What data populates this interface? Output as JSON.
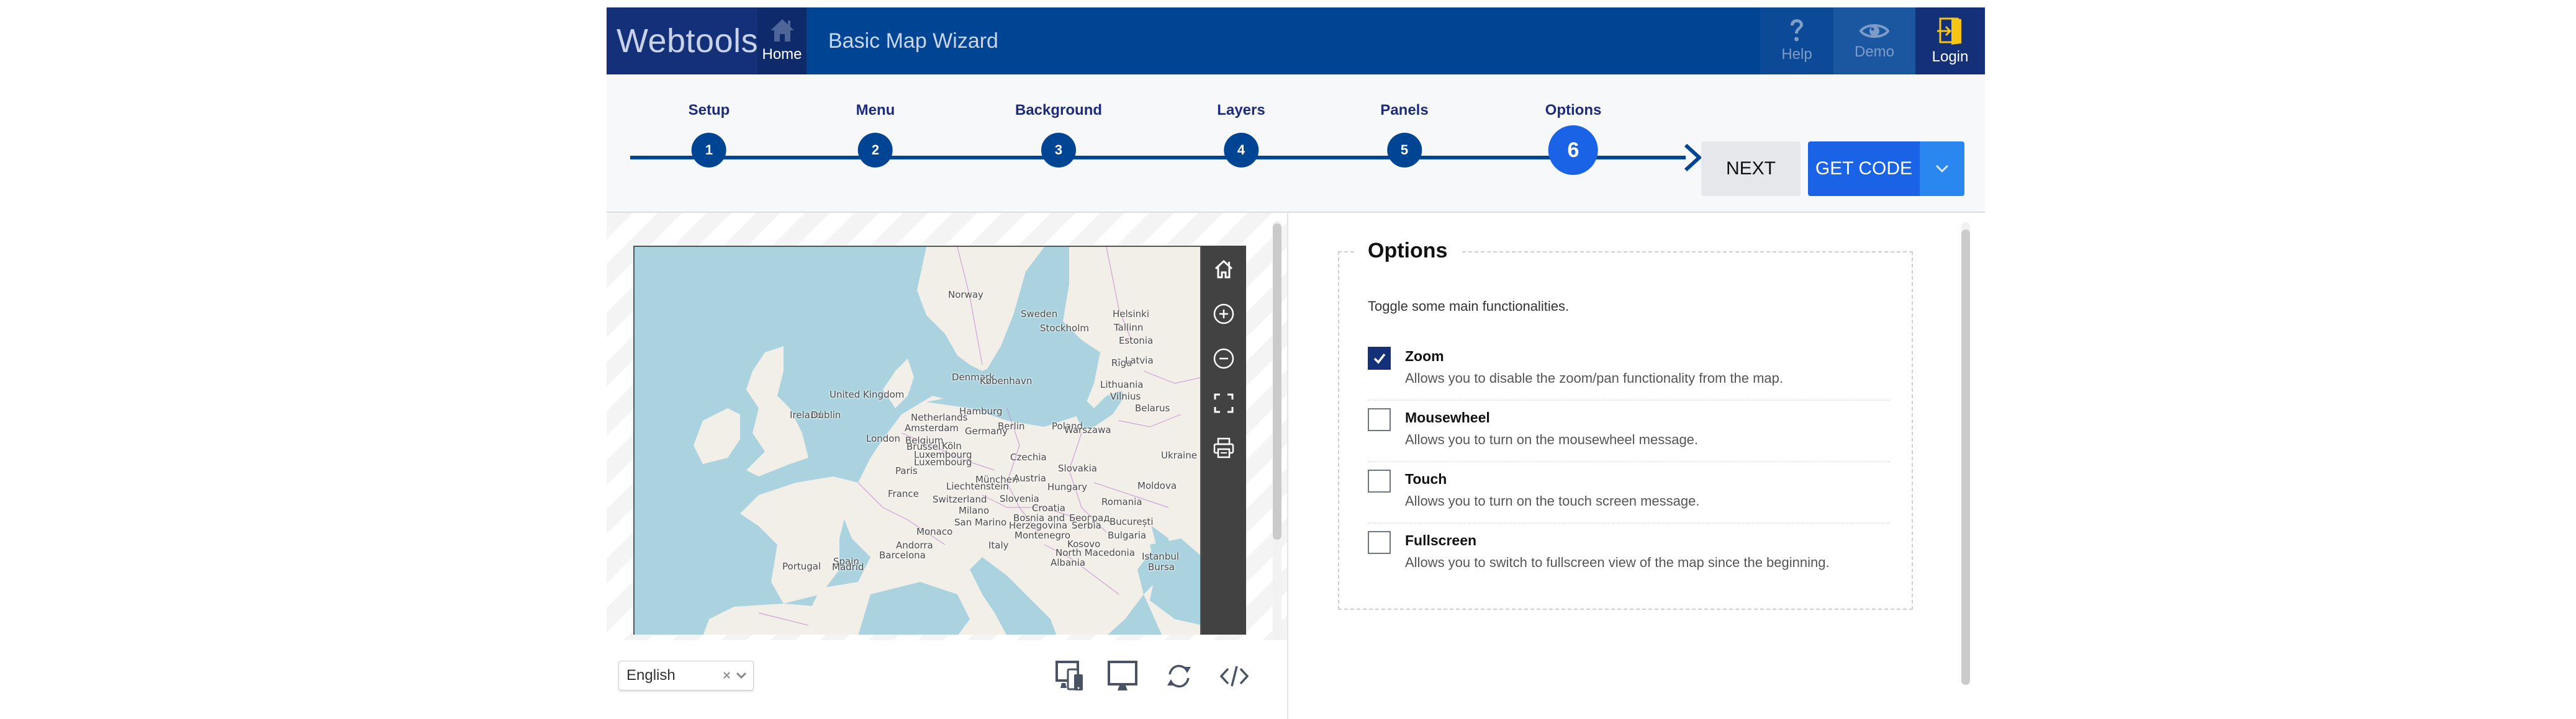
{
  "header": {
    "brand": "Webtools",
    "home_label": "Home",
    "app_title": "Basic Map Wizard",
    "help_label": "Help",
    "demo_label": "Demo",
    "login_label": "Login",
    "colors": {
      "brand_bg": "#143078",
      "bar_bg": "#004494",
      "login_icon": "#f7c614"
    }
  },
  "wizard": {
    "steps": [
      {
        "number": "1",
        "label": "Setup"
      },
      {
        "number": "2",
        "label": "Menu"
      },
      {
        "number": "3",
        "label": "Background"
      },
      {
        "number": "4",
        "label": "Layers"
      },
      {
        "number": "5",
        "label": "Panels"
      },
      {
        "number": "6",
        "label": "Options"
      }
    ],
    "active_step": 6,
    "next_label": "NEXT",
    "get_code_label": "GET CODE",
    "colors": {
      "step": "#004494",
      "active_step": "#1a62e6"
    }
  },
  "map": {
    "labels": [
      {
        "text": "Norway"
      },
      {
        "text": "Sweden"
      },
      {
        "text": "Helsinki"
      },
      {
        "text": "Stockholm"
      },
      {
        "text": "Tallinn"
      },
      {
        "text": "Estonia"
      },
      {
        "text": "Rīga"
      },
      {
        "text": "Latvia"
      },
      {
        "text": "Denmark"
      },
      {
        "text": "København"
      },
      {
        "text": "Lithuania"
      },
      {
        "text": "Vilnius"
      },
      {
        "text": "United Kingdom"
      },
      {
        "text": "Belarus"
      },
      {
        "text": "Ireland"
      },
      {
        "text": "Dublin"
      },
      {
        "text": "Hamburg"
      },
      {
        "text": "Netherlands"
      },
      {
        "text": "Amsterdam"
      },
      {
        "text": "Berlin"
      },
      {
        "text": "Poland"
      },
      {
        "text": "Warszawa"
      },
      {
        "text": "Germany"
      },
      {
        "text": "London"
      },
      {
        "text": "Belgium"
      },
      {
        "text": "Brussel"
      },
      {
        "text": "Köln"
      },
      {
        "text": "Luxembourg"
      },
      {
        "text": "Luxembourg"
      },
      {
        "text": "Czechia"
      },
      {
        "text": "Ukraine"
      },
      {
        "text": "Paris"
      },
      {
        "text": "Slovakia"
      },
      {
        "text": "München"
      },
      {
        "text": "Austria"
      },
      {
        "text": "Liechtenstein"
      },
      {
        "text": "Hungary"
      },
      {
        "text": "Moldova"
      },
      {
        "text": "France"
      },
      {
        "text": "Switzerland"
      },
      {
        "text": "Slovenia"
      },
      {
        "text": "Romania"
      },
      {
        "text": "Croatia"
      },
      {
        "text": "Milano"
      },
      {
        "text": "Bosnia and"
      },
      {
        "text": "Herzegovina"
      },
      {
        "text": "Београд"
      },
      {
        "text": "Serbia"
      },
      {
        "text": "San Marino"
      },
      {
        "text": "București"
      },
      {
        "text": "Monaco"
      },
      {
        "text": "Montenegro"
      },
      {
        "text": "Bulgaria"
      },
      {
        "text": "Kosovo"
      },
      {
        "text": "Andorra"
      },
      {
        "text": "Italy"
      },
      {
        "text": "North Macedonia"
      },
      {
        "text": "Barcelona"
      },
      {
        "text": "Istanbul"
      },
      {
        "text": "Spain"
      },
      {
        "text": "Madrid"
      },
      {
        "text": "Portugal"
      },
      {
        "text": "Albania"
      },
      {
        "text": "Bursa"
      }
    ],
    "tools": [
      "home-icon",
      "zoom-in-icon",
      "zoom-out-icon",
      "fullscreen-icon",
      "print-icon"
    ]
  },
  "bottombar": {
    "language": "English",
    "tools": [
      "responsive-devices-icon",
      "desktop-icon",
      "refresh-icon",
      "code-icon"
    ]
  },
  "options": {
    "title": "Options",
    "intro": "Toggle some main functionalities.",
    "items": [
      {
        "title": "Zoom",
        "description": "Allows you to disable the zoom/pan functionality from the map.",
        "checked": true
      },
      {
        "title": "Mousewheel",
        "description": "Allows you to turn on the mousewheel message.",
        "checked": false
      },
      {
        "title": "Touch",
        "description": "Allows you to turn on the touch screen message.",
        "checked": false
      },
      {
        "title": "Fullscreen",
        "description": "Allows you to switch to fullscreen view of the map since the beginning.",
        "checked": false
      }
    ]
  }
}
